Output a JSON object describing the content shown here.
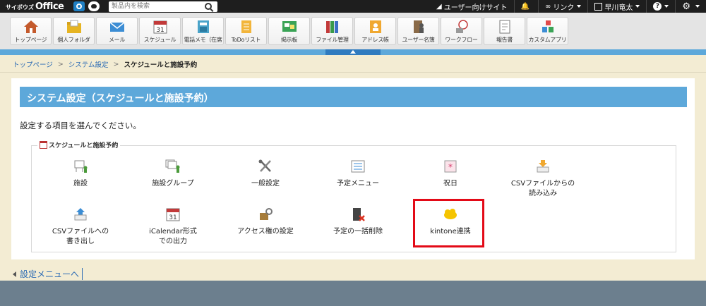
{
  "topbar": {
    "logo_small": "サイボウズ",
    "logo_big": "Office",
    "search_placeholder": "製品内を検索",
    "user_site": "ユーザー向けサイト",
    "link": "リンク",
    "user_name": "早川竜太",
    "help": "?",
    "settings": "⚙"
  },
  "apps": [
    {
      "label": "トップページ",
      "icon": "house-icon"
    },
    {
      "label": "個人フォルダ",
      "icon": "folder-icon"
    },
    {
      "label": "メール",
      "icon": "mail-icon"
    },
    {
      "label": "スケジュール",
      "icon": "calendar-icon"
    },
    {
      "label": "電話メモ（在席",
      "icon": "phone-memo-icon"
    },
    {
      "label": "ToDoリスト",
      "icon": "todo-icon"
    },
    {
      "label": "掲示板",
      "icon": "bulletin-board-icon"
    },
    {
      "label": "ファイル管理",
      "icon": "file-binder-icon"
    },
    {
      "label": "アドレス帳",
      "icon": "address-book-icon"
    },
    {
      "label": "ユーザー名簿",
      "icon": "user-directory-icon"
    },
    {
      "label": "ワークフロー",
      "icon": "workflow-icon"
    },
    {
      "label": "報告書",
      "icon": "report-icon"
    },
    {
      "label": "カスタムアプリ",
      "icon": "custom-app-icon"
    }
  ],
  "breadcrumb": {
    "home": "トップページ",
    "settings": "システム設定",
    "current": "スケジュールと施設予約"
  },
  "panel": {
    "title": "システム設定（スケジュールと施設予約）",
    "instruction": "設定する項目を選んでください。",
    "group_label": "スケジュールと施設予約"
  },
  "items": [
    {
      "line1": "施設",
      "line2": "",
      "icon": "facility-icon"
    },
    {
      "line1": "施設グループ",
      "line2": "",
      "icon": "facility-group-icon"
    },
    {
      "line1": "一般設定",
      "line2": "",
      "icon": "tools-icon"
    },
    {
      "line1": "予定メニュー",
      "line2": "",
      "icon": "menu-list-icon"
    },
    {
      "line1": "祝日",
      "line2": "",
      "icon": "holiday-icon"
    },
    {
      "line1": "CSVファイルからの",
      "line2": "読み込み",
      "icon": "csv-import-icon"
    },
    {
      "line1": "CSVファイルへの",
      "line2": "書き出し",
      "icon": "csv-export-icon"
    },
    {
      "line1": "iCalendar形式",
      "line2": "での出力",
      "icon": "icalendar-icon"
    },
    {
      "line1": "アクセス権の設定",
      "line2": "",
      "icon": "access-key-icon"
    },
    {
      "line1": "予定の一括削除",
      "line2": "",
      "icon": "bulk-delete-icon"
    },
    {
      "line1": "kintone連携",
      "line2": "",
      "icon": "kintone-icon"
    }
  ],
  "footer": {
    "back_label": "設定メニューへ"
  },
  "colors": {
    "accent_blue": "#5da8da",
    "highlight_red": "#e30a17",
    "page_bg": "#f3ecd3",
    "topbar": "#1e1e1e",
    "footer": "#6c7f8e"
  }
}
